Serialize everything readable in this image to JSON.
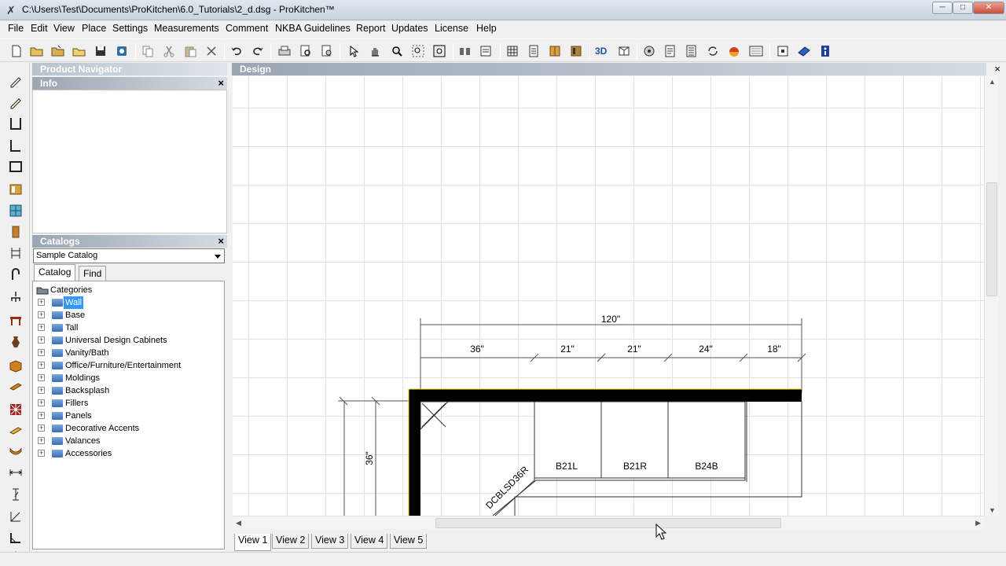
{
  "window": {
    "title": "C:\\Users\\Test\\Documents\\ProKitchen\\6.0_Tutorials\\2_d.dsg - ProKitchen™",
    "minimize": "─",
    "maximize": "□",
    "close": "✕"
  },
  "menu": [
    "File",
    "Edit",
    "View",
    "Place",
    "Settings",
    "Measurements",
    "Comment",
    "NKBA Guidelines",
    "Report",
    "Updates",
    "License",
    "Help"
  ],
  "panels": {
    "product_navigator": "Product Navigator",
    "info": "Info",
    "catalogs": "Catalogs",
    "close_glyph": "×",
    "catalog_selected": "Sample Catalog",
    "tabs": [
      "Catalog",
      "Find"
    ],
    "tree_root": "Categories",
    "tree_items": [
      "Wall",
      "Base",
      "Tall",
      "Universal Design Cabinets",
      "Vanity/Bath",
      "Office/Furniture/Entertainment",
      "Moldings",
      "Backsplash",
      "Fillers",
      "Panels",
      "Decorative Accents",
      "Valances",
      "Accessories"
    ],
    "tree_selected_index": 0
  },
  "design": {
    "header": "Design",
    "close_glyph": "×",
    "dims": {
      "overall": "120\"",
      "segments": [
        "36\"",
        "21\"",
        "21\"",
        "24\"",
        "18\""
      ],
      "depth": "36\""
    },
    "cabinets": [
      "B21L",
      "B21R",
      "B24B"
    ],
    "corner_cabinet": "DCBLSD36R",
    "view_tabs": [
      "View 1",
      "View 2",
      "View 3",
      "View 4",
      "View 5"
    ],
    "active_view": "View 1"
  },
  "toolbar_icons": [
    "new-icon",
    "open-icon",
    "open-template-icon",
    "open-folder-icon",
    "save-icon",
    "properties-icon",
    "copy-icon",
    "cut-icon",
    "paste-icon",
    "delete-icon",
    "undo-icon",
    "redo-icon",
    "print-icon",
    "print-preview-icon",
    "print-setup-icon",
    "select-icon",
    "pan-icon",
    "zoom-in-icon",
    "zoom-window-icon",
    "zoom-extents-icon",
    "catalog-icon",
    "price-icon",
    "grid-icon",
    "elevation-icon",
    "cabinet-icon",
    "wall-icon",
    "3d-icon",
    "perspective-icon",
    "render-icon",
    "report-icon",
    "list-icon",
    "refresh-icon",
    "lighting-icon",
    "texture-icon",
    "settings-icon",
    "help-book-icon",
    "info-icon"
  ],
  "leftstrip_icons": [
    "draw-wall-icon",
    "draw-line-icon",
    "u-shape-icon",
    "l-shape-icon",
    "room-icon",
    "door-icon",
    "window-icon",
    "opening-icon",
    "fixture-icon",
    "faucet-icon",
    "light-icon",
    "table-icon",
    "vase-icon",
    "box-icon",
    "molding-icon",
    "accent-icon",
    "countertop-icon",
    "valance-icon",
    "dimension-horizontal-icon",
    "dimension-vertical-icon",
    "dimension-angle-icon",
    "dimension-corner-icon",
    "dimension-height-icon"
  ]
}
